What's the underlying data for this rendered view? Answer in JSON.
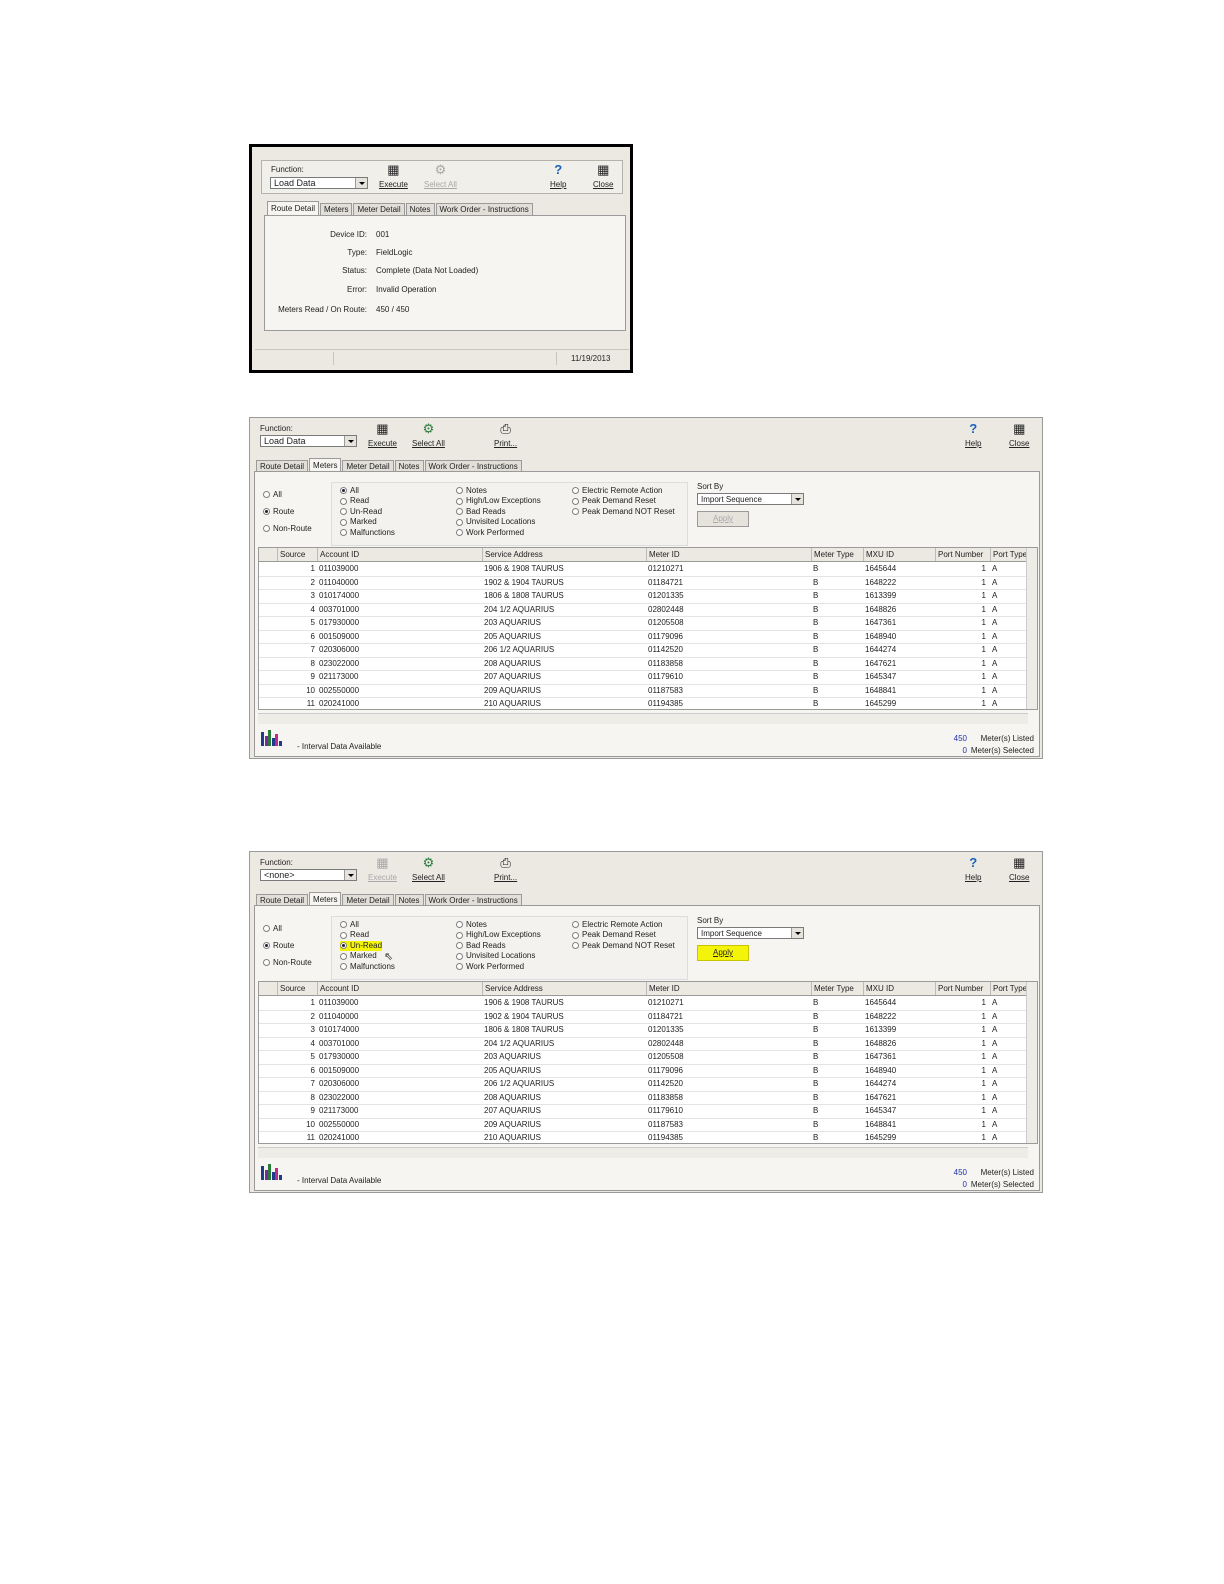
{
  "toolbar": {
    "function_label": "Function:",
    "execute": "Execute",
    "select_all": "Select All",
    "print": "Print...",
    "help": "Help",
    "close": "Close"
  },
  "tabs": [
    "Route Detail",
    "Meters",
    "Meter Detail",
    "Notes",
    "Work Order - Instructions"
  ],
  "shot1": {
    "function_value": "Load Data",
    "fields": [
      {
        "label": "Device ID:",
        "value": "001"
      },
      {
        "label": "Type:",
        "value": "FieldLogic"
      },
      {
        "label": "Status:",
        "value": "Complete     (Data Not Loaded)"
      },
      {
        "label": "Error:",
        "value": "Invalid Operation"
      },
      {
        "label": "Meters Read / On Route:",
        "value": "450 / 450"
      }
    ],
    "status_date": "11/19/2013"
  },
  "filters": {
    "scope": [
      "All",
      "Route",
      "Non-Route"
    ],
    "col1": [
      "All",
      "Read",
      "Un-Read",
      "Marked",
      "Malfunctions"
    ],
    "col2": [
      "Notes",
      "High/Low Exceptions",
      "Bad Reads",
      "Unvisited Locations",
      "Work Performed"
    ],
    "col3": [
      "Electric Remote Action",
      "Peak Demand Reset",
      "Peak Demand NOT Reset"
    ],
    "sort_by_label": "Sort By",
    "sort_value": "Import Sequence",
    "apply": "Apply"
  },
  "shot2": {
    "function_value": "Load Data"
  },
  "shot3": {
    "function_value": "<none>"
  },
  "table": {
    "columns": [
      "Source",
      "Account ID",
      "Service Address",
      "Meter ID",
      "Meter Type",
      "MXU ID",
      "Port Number",
      "Port Type"
    ],
    "rows": [
      [
        "1",
        "011039000",
        "1906 & 1908 TAURUS",
        "01210271",
        "B",
        "1645644",
        "1",
        "A"
      ],
      [
        "2",
        "011040000",
        "1902 & 1904 TAURUS",
        "01184721",
        "B",
        "1648222",
        "1",
        "A"
      ],
      [
        "3",
        "010174000",
        "1806 & 1808 TAURUS",
        "01201335",
        "B",
        "1613399",
        "1",
        "A"
      ],
      [
        "4",
        "003701000",
        "204 1/2 AQUARIUS",
        "02802448",
        "B",
        "1648826",
        "1",
        "A"
      ],
      [
        "5",
        "017930000",
        "203 AQUARIUS",
        "01205508",
        "B",
        "1647361",
        "1",
        "A"
      ],
      [
        "6",
        "001509000",
        "205 AQUARIUS",
        "01179096",
        "B",
        "1648940",
        "1",
        "A"
      ],
      [
        "7",
        "020306000",
        "206 1/2 AQUARIUS",
        "01142520",
        "B",
        "1644274",
        "1",
        "A"
      ],
      [
        "8",
        "023022000",
        "208 AQUARIUS",
        "01183858",
        "B",
        "1647621",
        "1",
        "A"
      ],
      [
        "9",
        "021173000",
        "207 AQUARIUS",
        "01179610",
        "B",
        "1645347",
        "1",
        "A"
      ],
      [
        "10",
        "002550000",
        "209 AQUARIUS",
        "01187583",
        "B",
        "1648841",
        "1",
        "A"
      ],
      [
        "11",
        "020241000",
        "210 AQUARIUS",
        "01194385",
        "B",
        "1645299",
        "1",
        "A"
      ]
    ]
  },
  "footer": {
    "interval_text": "- Interval Data Available",
    "listed_count": "450",
    "listed_label": "Meter(s) Listed",
    "selected_count": "0",
    "selected_label": "Meter(s) Selected"
  }
}
